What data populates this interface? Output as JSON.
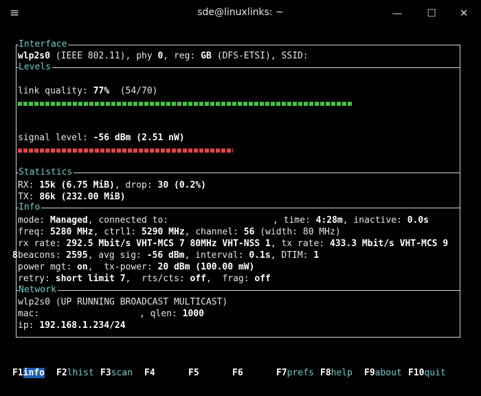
{
  "window": {
    "title": "sde@linuxlinks: ~",
    "menu_glyph": "≡",
    "minimize_glyph": "—",
    "maximize_glyph": "☐",
    "close_glyph": "✕"
  },
  "sections": {
    "interface": "Interface",
    "levels": "Levels",
    "statistics": "Statistics",
    "info": "Info",
    "network": "Network"
  },
  "interface": {
    "dev": "wlp2s0",
    "ieee": " (IEEE 802.11), phy ",
    "phy": "0",
    "reg_label": ", reg: ",
    "reg": "GB",
    "rest": " (DFS-ETSI), SSID:"
  },
  "levels": {
    "lq_label": "link quality: ",
    "lq_val": "77%",
    "lq_rest": "  (54/70)",
    "lq_fraction": 0.77,
    "sig_label": "signal level: ",
    "sig_val": "-56 dBm (2.51 nW)"
  },
  "stats": {
    "rx_label": "RX: ",
    "rx_val": "15k (6.75 MiB)",
    "rx_drop_label": ", drop: ",
    "rx_drop_val": "30 (0.2%)",
    "tx_label": "TX: ",
    "tx_val": "86k (232.00 MiB)"
  },
  "info": {
    "mode_label": "mode: ",
    "mode_val": "Managed",
    "conn_label": ", connected to:",
    "time_label": ", time: ",
    "time_val": "4:28m",
    "inactive_label": ", inactive: ",
    "inactive_val": "0.0s",
    "freq_label": "freq: ",
    "freq_val": "5280 MHz",
    "ctrl_label": ", ctrl1: ",
    "ctrl_val": "5290 MHz",
    "chan_label": ", channel: ",
    "chan_val": "56",
    "chan_rest": " (width: 80 MHz)",
    "rx_label": "rx rate: ",
    "rx_val": "292.5 Mbit/s VHT-MCS 7 80MHz VHT-NSS 1",
    "tx_label": ", tx rate: ",
    "tx_val": "433.3 Mbit/s VHT-MCS 9",
    "wrap": "8",
    "beacons_label": "beacons: ",
    "beacons_val": "2595",
    "avg_label": ", avg sig: ",
    "avg_val": "-56 dBm",
    "interval_label": ", interval: ",
    "interval_val": "0.1s",
    "dtim_label": ", DTIM: ",
    "dtim_val": "1",
    "pm_label": "power mgt: ",
    "pm_val": "on",
    "txp_label": ",  tx-power: ",
    "txp_val": "20 dBm (100.00 mW)",
    "retry_label": "retry: ",
    "retry_val": "short limit 7",
    "rts_label": ",  rts/cts: ",
    "rts_val": "off",
    "frag_label": ",  frag: ",
    "frag_val": "off"
  },
  "network": {
    "line1": "wlp2s0 (UP RUNNING BROADCAST MULTICAST)",
    "mac_label": "mac: ",
    "qlen_label": ", qlen: ",
    "qlen_val": "1000",
    "ip_label": "ip: ",
    "ip_val": "192.168.1.234/24"
  },
  "fkeys": [
    {
      "key": "F1",
      "label": "info"
    },
    {
      "key": "F2",
      "label": "lhist"
    },
    {
      "key": "F3",
      "label": "scan"
    },
    {
      "key": "F4",
      "label": ""
    },
    {
      "key": "F5",
      "label": ""
    },
    {
      "key": "F6",
      "label": ""
    },
    {
      "key": "F7",
      "label": "prefs"
    },
    {
      "key": "F8",
      "label": "help"
    },
    {
      "key": "F9",
      "label": "about"
    },
    {
      "key": "F10",
      "label": "quit"
    }
  ],
  "colors": {
    "accent": "#6fd0c8",
    "bar_good": "#3fc43f",
    "bar_bad": "#e24545",
    "selected": "#1b5fb7"
  }
}
